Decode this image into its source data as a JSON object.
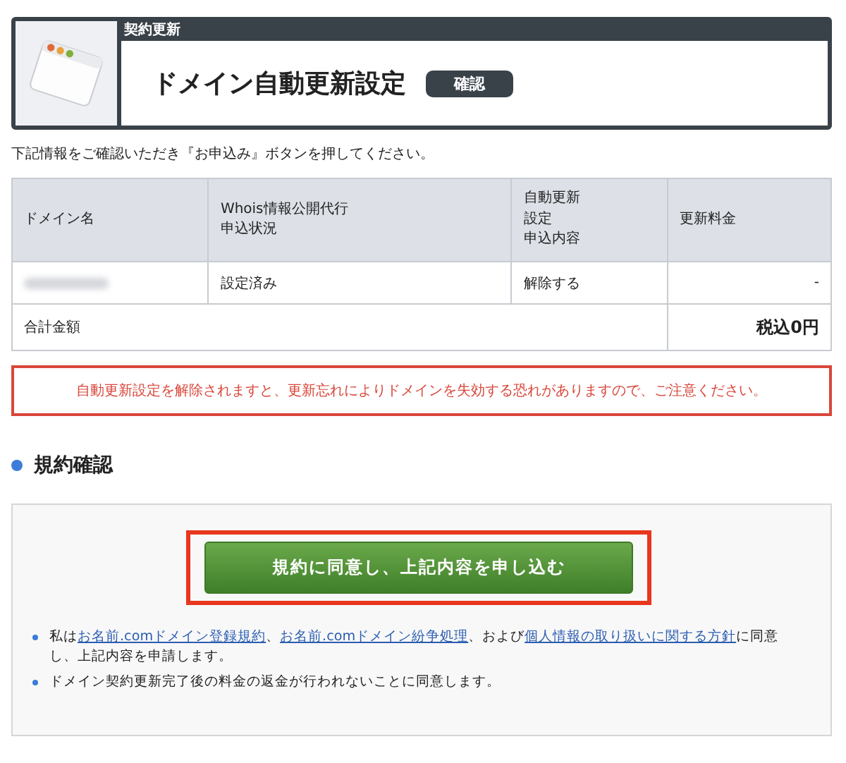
{
  "header": {
    "category": "契約更新",
    "title": "ドメイン自動更新設定",
    "badge": "確認"
  },
  "instruction": "下記情報をご確認いただき『お申込み』ボタンを押してください。",
  "table": {
    "columns": [
      {
        "lines": [
          "ドメイン名"
        ]
      },
      {
        "lines": [
          "Whois情報公開代行",
          "申込状況"
        ]
      },
      {
        "lines": [
          "自動更新",
          "設定",
          "申込内容"
        ]
      },
      {
        "lines": [
          "更新料金"
        ]
      }
    ],
    "rows": [
      {
        "domain_redacted": true,
        "cells": [
          "",
          "設定済み",
          "解除する",
          "-"
        ]
      }
    ],
    "total": {
      "label": "合計金額",
      "value": "税込0円"
    }
  },
  "warning": "自動更新設定を解除されますと、更新忘れによりドメインを失効する恐れがありますので、ご注意ください。",
  "terms": {
    "heading": "規約確認",
    "button": "規約に同意し、上記内容を申し込む",
    "highlighted": true,
    "notes": [
      {
        "segments": [
          {
            "text": "私は",
            "link": false
          },
          {
            "text": "お名前.comドメイン登録規約",
            "link": true
          },
          {
            "text": "、",
            "link": false
          },
          {
            "text": "お名前.comドメイン紛争処理",
            "link": true
          },
          {
            "text": "、および",
            "link": false
          },
          {
            "text": "個人情報の取り扱いに関する方針",
            "link": true
          },
          {
            "text": "に同意し、上記内容を申請します。",
            "link": false
          }
        ]
      },
      {
        "segments": [
          {
            "text": "ドメイン契約更新完了後の料金の返金が行われないことに同意します。",
            "link": false
          }
        ]
      }
    ]
  }
}
